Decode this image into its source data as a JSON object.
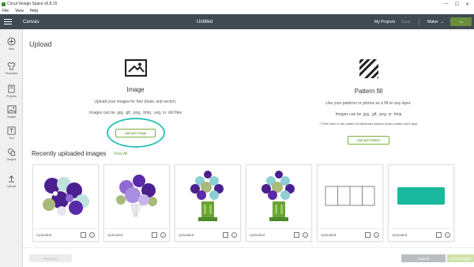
{
  "window": {
    "title": "Cricut Design Space  v5.8.15",
    "controls": [
      "—",
      "☐",
      "✕"
    ]
  },
  "menu": [
    "File",
    "View",
    "Help"
  ],
  "header": {
    "canvas_label": "Canvas",
    "doc_title": "Untitled",
    "my_projects": "My Projects",
    "save": "Save",
    "machine": "Maker",
    "go": "Go"
  },
  "sidebar": {
    "items": [
      {
        "label": "New",
        "icon": "plus-icon"
      },
      {
        "label": "Templates",
        "icon": "shirt-icon"
      },
      {
        "label": "Projects",
        "icon": "book-icon"
      },
      {
        "label": "Images",
        "icon": "image-icon"
      },
      {
        "label": "Text",
        "icon": "text-icon"
      },
      {
        "label": "Shapes",
        "icon": "shapes-icon"
      },
      {
        "label": "Upload",
        "icon": "upload-icon"
      }
    ]
  },
  "upload": {
    "heading": "Upload",
    "image_option": {
      "title": "Image",
      "desc": "Upload your images for free (basic and vector).",
      "types": "Images can be .jpg, .gif, .png, .bmp, .svg, or .dxf files",
      "button": "Upload Image"
    },
    "pattern_option": {
      "title": "Pattern fill",
      "desc": "Use your patterns or photos as a fill on any layer.",
      "types": "Images can be .jpg, .gif, .png, or .bmp",
      "note": "Find them in the pattern fill attributes swatch under pattern print type.",
      "button": "Upload Pattern"
    }
  },
  "recent": {
    "heading": "Recently uploaded images",
    "view_all": "View All",
    "cards": [
      {
        "label": "Uploaded",
        "thumb": "purple-flowers-with-pansy"
      },
      {
        "label": "Uploaded",
        "thumb": "purple-flower-bouquet"
      },
      {
        "label": "Uploaded",
        "thumb": "flowers-in-green-vase"
      },
      {
        "label": "Uploaded",
        "thumb": "flowers-in-green-vase"
      },
      {
        "label": "Uploaded",
        "thumb": "four-panel-outline"
      },
      {
        "label": "Uploaded",
        "thumb": "teal-rectangle"
      }
    ]
  },
  "footer": {
    "previous": "Previous",
    "cancel": "Cancel",
    "next": "Insert Images"
  },
  "colors": {
    "header_bg": "#404a52",
    "accent_green": "#7eb13a",
    "highlight_ring": "#2ec4b6",
    "teal_shape": "#1ab99e"
  }
}
